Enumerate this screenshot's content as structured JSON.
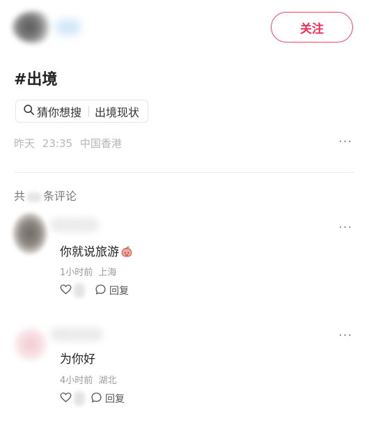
{
  "header": {
    "follow_label": "关注"
  },
  "post": {
    "tag": "#出境",
    "search_chip": {
      "label": "猜你想搜",
      "query": "出境现状"
    },
    "meta": {
      "date": "昨天",
      "time": "23:35",
      "location": "中国香港"
    }
  },
  "comments_section": {
    "count_prefix": "共",
    "count_suffix": "条评论",
    "reply_label": "回复",
    "comments": [
      {
        "text": "你就说旅游",
        "emoji": "peach-face",
        "time": "1小时前",
        "location": "上海"
      },
      {
        "text": "为你好",
        "time": "4小时前",
        "location": "湖北"
      }
    ]
  },
  "icons": [
    "search-icon",
    "more-dots-icon",
    "heart-icon",
    "comment-bubble-icon"
  ],
  "colors": {
    "accent": "#ef2d55",
    "muted": "#b6b6b6",
    "divider": "#ededed"
  }
}
